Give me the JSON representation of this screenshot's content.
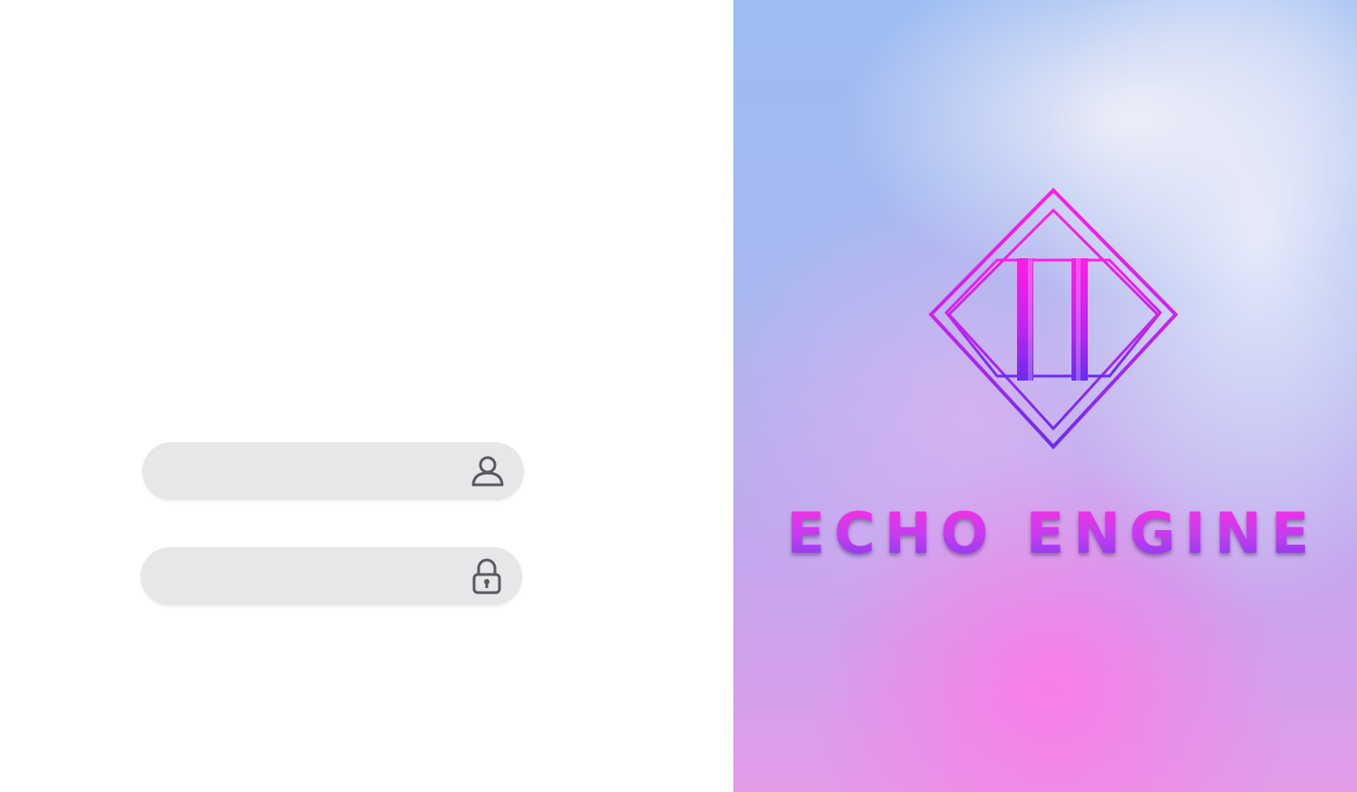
{
  "login": {
    "username": {
      "value": "",
      "placeholder": "",
      "icon": "user-icon"
    },
    "password": {
      "value": "",
      "placeholder": "",
      "icon": "lock-icon"
    }
  },
  "brand": {
    "name": "ECHO ENGINE",
    "logo": "echo-engine-logo",
    "colors": {
      "magenta": "#ff2ee0",
      "violet": "#7a3cf0"
    }
  }
}
